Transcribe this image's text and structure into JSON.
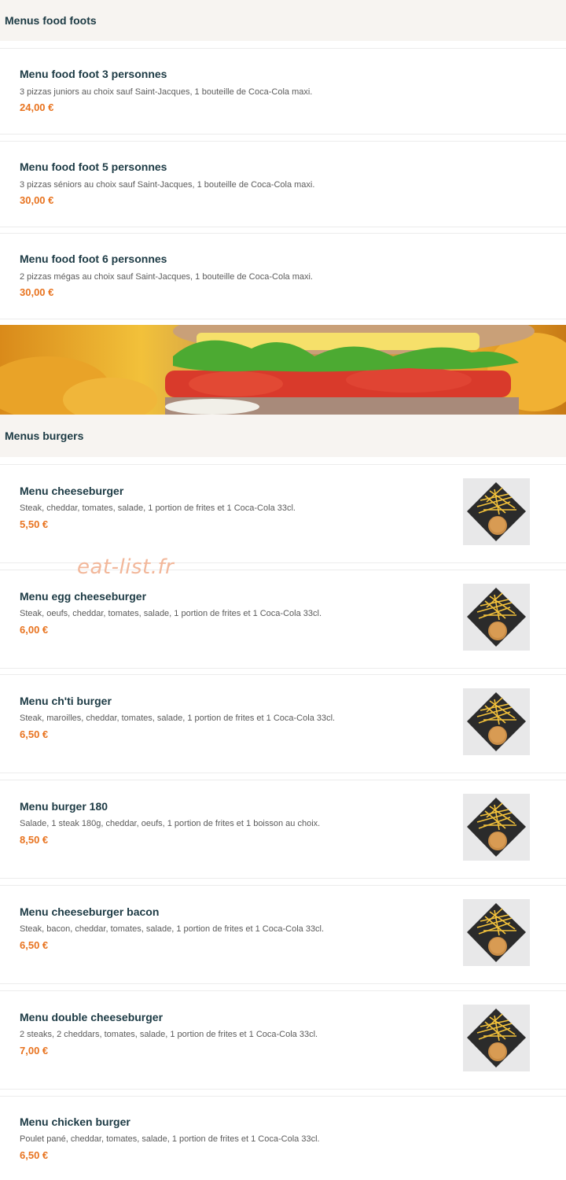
{
  "sections": [
    {
      "heading": "Menus food foots",
      "items": [
        {
          "name": "Menu food foot 3 personnes",
          "description": "3 pizzas juniors au choix sauf Saint-Jacques, 1 bouteille de Coca-Cola maxi.",
          "price": "24,00 €"
        },
        {
          "name": "Menu food foot 5 personnes",
          "description": "3 pizzas séniors au choix sauf Saint-Jacques, 1 bouteille de Coca-Cola maxi.",
          "price": "30,00 €"
        },
        {
          "name": "Menu food foot 6 personnes",
          "description": "2 pizzas mégas au choix sauf Saint-Jacques, 1 bouteille de Coca-Cola maxi.",
          "price": "30,00 €"
        }
      ]
    },
    {
      "heading": "Menus burgers",
      "items": [
        {
          "name": "Menu cheeseburger",
          "description": "Steak, cheddar, tomates, salade, 1 portion de frites et 1 Coca-Cola 33cl.",
          "price": "5,50 €"
        },
        {
          "name": "Menu egg cheeseburger",
          "description": "Steak, oeufs, cheddar, tomates, salade, 1 portion de frites et 1 Coca-Cola 33cl.",
          "price": "6,00 €"
        },
        {
          "name": "Menu ch'ti burger",
          "description": "Steak, maroilles, cheddar, tomates, salade, 1 portion de frites et 1 Coca-Cola 33cl.",
          "price": "6,50 €"
        },
        {
          "name": "Menu burger 180",
          "description": "Salade, 1 steak 180g, cheddar, oeufs, 1 portion de frites et 1 boisson au choix.",
          "price": "8,50 €"
        },
        {
          "name": "Menu cheeseburger bacon",
          "description": "Steak, bacon, cheddar, tomates, salade, 1 portion de frites et 1 Coca-Cola 33cl.",
          "price": "6,50 €"
        },
        {
          "name": "Menu double cheeseburger",
          "description": "2 steaks, 2 cheddars, tomates, salade, 1 portion de frites et 1 Coca-Cola 33cl.",
          "price": "7,00 €"
        },
        {
          "name": "Menu chicken burger",
          "description": "Poulet pané, cheddar, tomates, salade, 1 portion de frites et 1 Coca-Cola 33cl.",
          "price": "6,50 €"
        }
      ]
    }
  ],
  "watermark": "eat-list.fr",
  "colors": {
    "title": "#1c3a44",
    "price": "#e8731f",
    "section_bg": "#f7f4f1"
  }
}
